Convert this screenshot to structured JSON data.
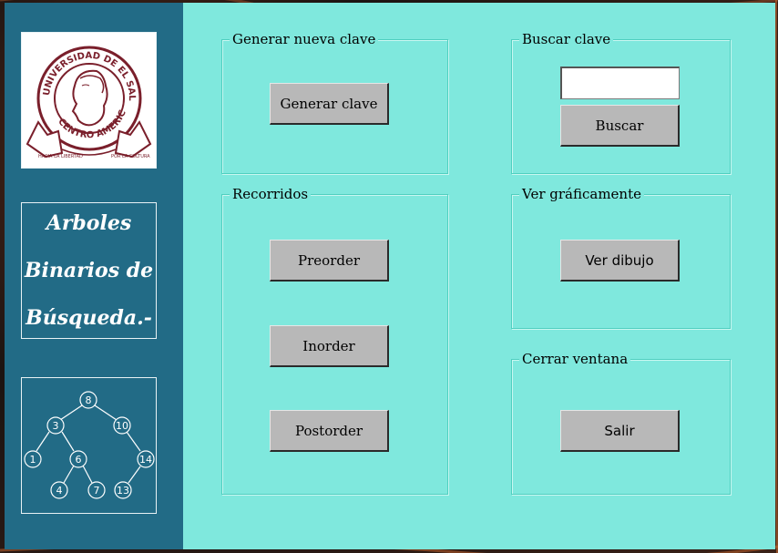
{
  "sidebar": {
    "title_lines": [
      "Arboles",
      "Binarios de",
      "Búsqueda.-"
    ],
    "logo_text": {
      "ring": "UNIVERSIDAD DE EL SALVADOR",
      "bottom": "CENTRO AMERICA",
      "left_ribbon": "HACIA LA LIBERTAD",
      "right_ribbon": "POR LA CULTURA"
    },
    "tree_nodes": [
      "8",
      "3",
      "10",
      "1",
      "6",
      "14",
      "4",
      "7",
      "13"
    ]
  },
  "groups": {
    "generate": {
      "title": "Generar nueva clave",
      "button": "Generar clave"
    },
    "search": {
      "title": "Buscar clave",
      "input_value": "",
      "button": "Buscar"
    },
    "traversals": {
      "title": "Recorridos",
      "preorder": "Preorder",
      "inorder": "Inorder",
      "postorder": "Postorder"
    },
    "graphic": {
      "title": "Ver gráficamente",
      "button": "Ver dibujo"
    },
    "close": {
      "title": "Cerrar ventana",
      "button": "Salir"
    }
  },
  "colors": {
    "window_bg": "#7fe8dd",
    "sidebar_bg": "#226b86",
    "button_bg": "#b8b8b8",
    "logo_maroon": "#7a1f2b"
  }
}
